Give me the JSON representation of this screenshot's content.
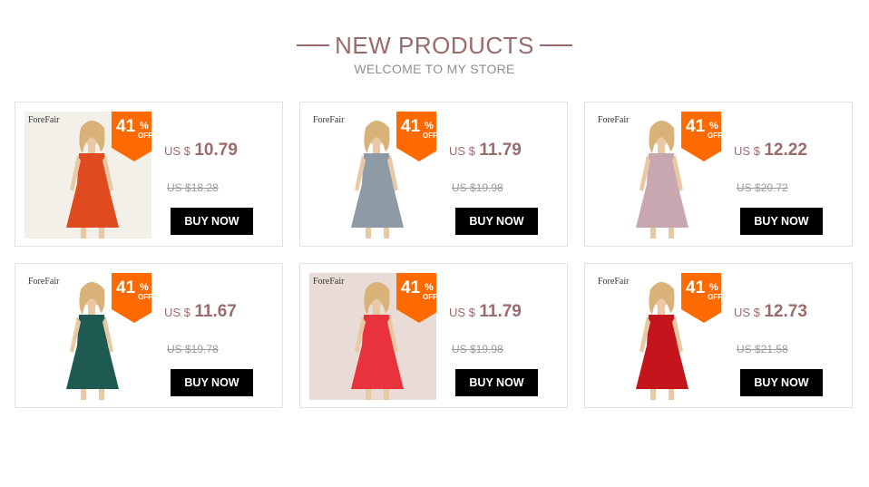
{
  "header": {
    "title": "NEW PRODUCTS",
    "subtitle": "WELCOME TO MY STORE"
  },
  "colors": {
    "accent": "#9b6b6b",
    "badge": "#ff6a00",
    "button": "#000000"
  },
  "products": [
    {
      "brand": "ForeFair",
      "discount": "41",
      "pct": "%",
      "off": "OFF",
      "currency": "US $",
      "price": "10.79",
      "old_price": "US $18.28",
      "button": "BUY NOW",
      "dress_color": "#e04a1f",
      "bg": "#f3efe9",
      "icon": "dress-photo"
    },
    {
      "brand": "ForeFair",
      "discount": "41",
      "pct": "%",
      "off": "OFF",
      "currency": "US $",
      "price": "11.79",
      "old_price": "US $19.98",
      "button": "BUY NOW",
      "dress_color": "#8e9aa6",
      "bg": "#ffffff",
      "icon": "dress-photo"
    },
    {
      "brand": "ForeFair",
      "discount": "41",
      "pct": "%",
      "off": "OFF",
      "currency": "US $",
      "price": "12.22",
      "old_price": "US $20.72",
      "button": "BUY NOW",
      "dress_color": "#c9a7b0",
      "bg": "#ffffff",
      "icon": "dress-photo"
    },
    {
      "brand": "ForeFair",
      "discount": "41",
      "pct": "%",
      "off": "OFF",
      "currency": "US $",
      "price": "11.67",
      "old_price": "US $19.78",
      "button": "BUY NOW",
      "dress_color": "#1f5a52",
      "bg": "#ffffff",
      "icon": "dress-photo"
    },
    {
      "brand": "ForeFair",
      "discount": "41",
      "pct": "%",
      "off": "OFF",
      "currency": "US $",
      "price": "11.79",
      "old_price": "US $19.98",
      "button": "BUY NOW",
      "dress_color": "#e8333c",
      "bg": "#e9dcd6",
      "icon": "dress-photo"
    },
    {
      "brand": "ForeFair",
      "discount": "41",
      "pct": "%",
      "off": "OFF",
      "currency": "US $",
      "price": "12.73",
      "old_price": "US $21.58",
      "button": "BUY NOW",
      "dress_color": "#c4141c",
      "bg": "#ffffff",
      "icon": "dress-photo"
    }
  ]
}
